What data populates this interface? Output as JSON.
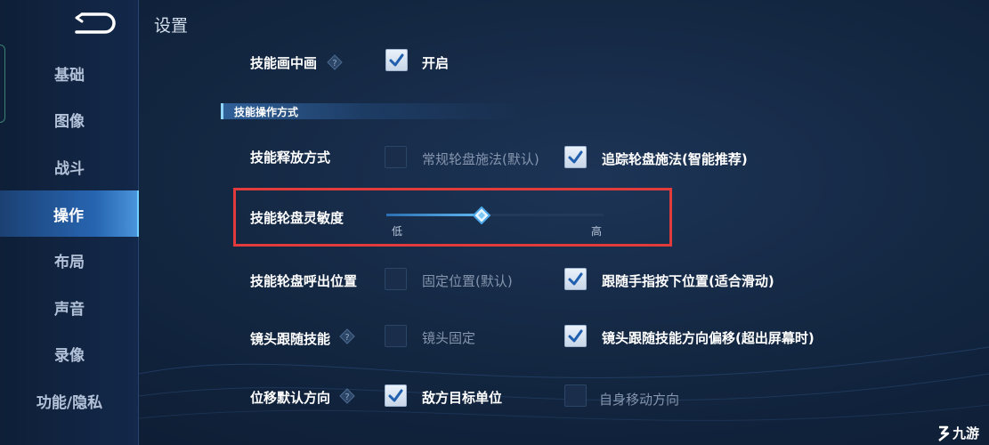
{
  "header": {
    "title": "设置"
  },
  "sidebar": {
    "items": [
      {
        "label": "基础",
        "active": false
      },
      {
        "label": "图像",
        "active": false
      },
      {
        "label": "战斗",
        "active": false
      },
      {
        "label": "操作",
        "active": true
      },
      {
        "label": "布局",
        "active": false
      },
      {
        "label": "声音",
        "active": false
      },
      {
        "label": "录像",
        "active": false
      },
      {
        "label": "功能/隐私",
        "active": false
      }
    ]
  },
  "settings": {
    "skill_preview": {
      "label": "技能画中画",
      "option": "开启",
      "checked": true
    },
    "section_title": "技能操作方式",
    "cast_mode": {
      "label": "技能释放方式",
      "options": [
        {
          "text": "常规轮盘施法(默认)",
          "checked": false
        },
        {
          "text": "追踪轮盘施法(智能推荐)",
          "checked": true
        }
      ]
    },
    "wheel_sensitivity": {
      "label": "技能轮盘灵敏度",
      "low_label": "低",
      "high_label": "高",
      "value": 0.44
    },
    "wheel_position": {
      "label": "技能轮盘呼出位置",
      "options": [
        {
          "text": "固定位置(默认)",
          "checked": false
        },
        {
          "text": "跟随手指按下位置(适合滑动)",
          "checked": true
        }
      ]
    },
    "camera_follow": {
      "label": "镜头跟随技能",
      "options": [
        {
          "text": "镜头固定",
          "checked": false
        },
        {
          "text": "镜头跟随技能方向偏移(超出屏幕时)",
          "checked": true
        }
      ]
    },
    "move_direction": {
      "label": "位移默认方向",
      "options": [
        {
          "text": "敌方目标单位",
          "checked": true
        },
        {
          "text": "自身移动方向",
          "checked": false
        }
      ]
    }
  },
  "watermark": {
    "text": "九游"
  },
  "colors": {
    "accent": "#5fb8f0",
    "highlight": "#e23b3b",
    "active_tab": "#2a70c4"
  }
}
